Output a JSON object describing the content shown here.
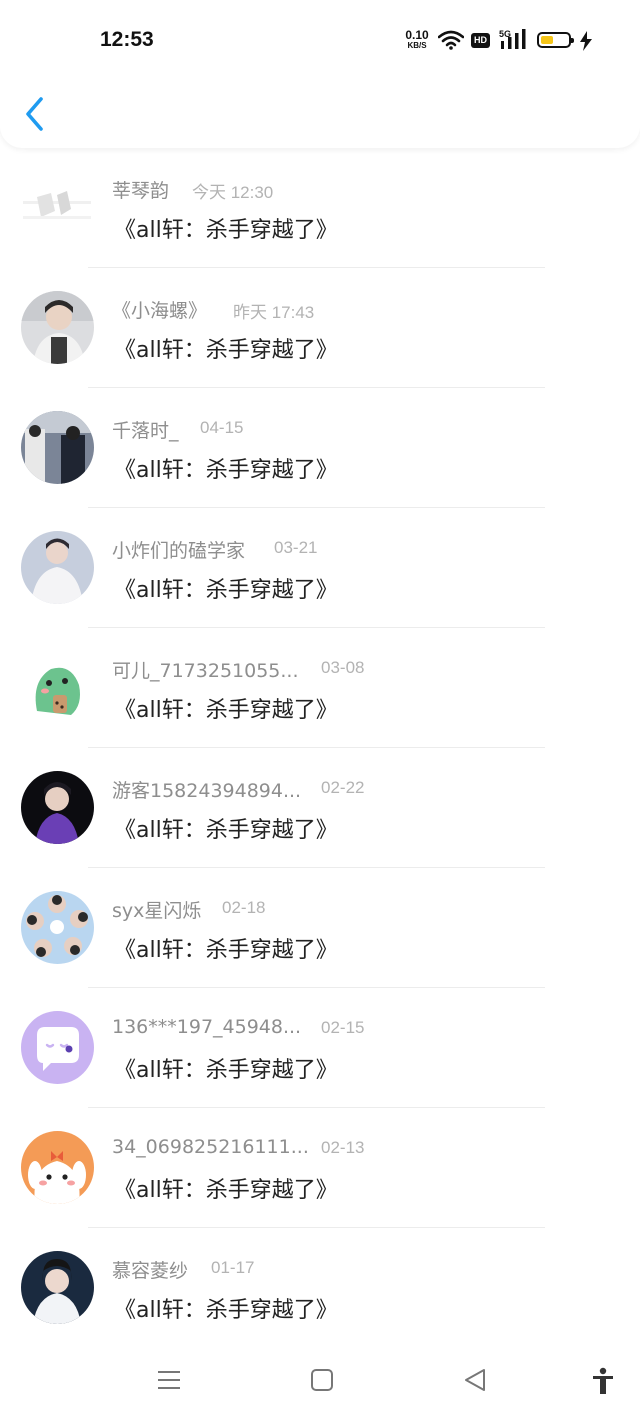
{
  "status_bar": {
    "time": "12:53",
    "net_speed_value": "0.10",
    "net_speed_unit": "KB/S",
    "hd_label": "HD",
    "network_type": "5G",
    "battery_color": "#f5c518"
  },
  "header": {
    "back_icon": "chevron-left-icon",
    "accent_color": "#1f9bf0"
  },
  "messages": [
    {
      "name": "莘琴韵",
      "time": "今天 12:30",
      "title": "《all轩：杀手穿越了》"
    },
    {
      "name": "《小海螺》",
      "time": "昨天 17:43",
      "title": "《all轩：杀手穿越了》"
    },
    {
      "name": "千落时_",
      "time": "04-15",
      "title": "《all轩：杀手穿越了》"
    },
    {
      "name": "小炸们的磕学家",
      "time": "03-21",
      "title": "《all轩：杀手穿越了》"
    },
    {
      "name": "可儿_7173251055...",
      "time": "03-08",
      "title": "《all轩：杀手穿越了》"
    },
    {
      "name": "游客15824394894...",
      "time": "02-22",
      "title": "《all轩：杀手穿越了》"
    },
    {
      "name": "syx星闪烁",
      "time": "02-18",
      "title": "《all轩：杀手穿越了》"
    },
    {
      "name": "136***197_45948...",
      "time": "02-15",
      "title": "《all轩：杀手穿越了》"
    },
    {
      "name": "34_069825216111...",
      "time": "02-13",
      "title": "《all轩：杀手穿越了》"
    },
    {
      "name": "慕容菱纱",
      "time": "01-17",
      "title": "《all轩：杀手穿越了》"
    }
  ],
  "navbar": {
    "menu_icon": "menu-icon",
    "home_icon": "home-icon",
    "back_icon": "back-triangle-icon",
    "accessibility_icon": "accessibility-icon"
  }
}
